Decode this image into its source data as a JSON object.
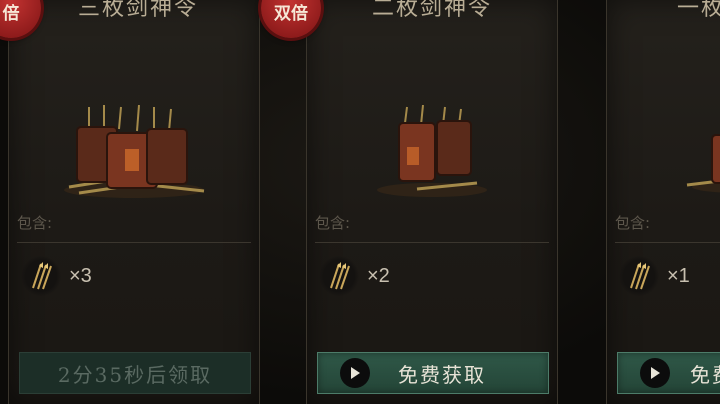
{
  "cards": [
    {
      "title": "三枚剑神令",
      "badge": "倍",
      "contains_label": "包含:",
      "reward_qty": "×3",
      "button_label": "2分35秒后领取",
      "button_state": "cooldown"
    },
    {
      "title": "二枚剑神令",
      "badge": "双倍",
      "contains_label": "包含:",
      "reward_qty": "×2",
      "button_label": "免费获取",
      "button_state": "free"
    },
    {
      "title": "一枚",
      "contains_label": "包含:",
      "reward_qty": "×1",
      "button_label": "免费",
      "button_state": "free"
    }
  ],
  "icons": {
    "item": "arrow-quiver-icon",
    "reward": "arrow-bundle-icon",
    "play": "play-icon"
  },
  "colors": {
    "button_active": "#2f5848",
    "button_disabled": "#1c2e27",
    "badge": "#c23331"
  }
}
